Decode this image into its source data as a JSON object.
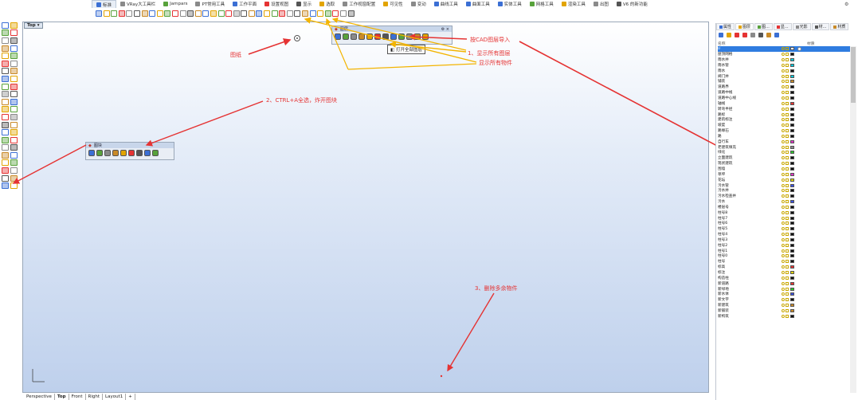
{
  "tabs": [
    {
      "label": "标准",
      "color": "#3b6fd4",
      "active": true
    },
    {
      "label": "VRay大工具栏",
      "color": "#8a8a8a"
    },
    {
      "label": "Jampars",
      "color": "#58a23b"
    },
    {
      "label": "PT常用工具",
      "color": "#8a8a8a"
    },
    {
      "label": "工作平面",
      "color": "#3b6fd4"
    },
    {
      "label": "设置视图",
      "color": "#e53333"
    },
    {
      "label": "显示",
      "color": "#555555"
    },
    {
      "label": "选取",
      "color": "#e2a400"
    },
    {
      "label": "工作视窗配置",
      "color": "#8a8a8a"
    },
    {
      "label": "可见性",
      "color": "#e2a400"
    },
    {
      "label": "变动",
      "color": "#8a8a8a"
    },
    {
      "label": "曲线工具",
      "color": "#3b6fd4"
    },
    {
      "label": "曲面工具",
      "color": "#3b6fd4"
    },
    {
      "label": "实体工具",
      "color": "#3b6fd4"
    },
    {
      "label": "网格工具",
      "color": "#58a23b"
    },
    {
      "label": "渲染工具",
      "color": "#e2a400"
    },
    {
      "label": "出图",
      "color": "#8a8a8a"
    },
    {
      "label": "V6 的新功能",
      "color": "#555555"
    }
  ],
  "toolbar_icons": [
    "new-file",
    "open-file",
    "save",
    "print",
    "import",
    "cut",
    "copy",
    "paste",
    "undo",
    "pan",
    "rotate",
    "zoom",
    "zoom-window",
    "zoom-extents",
    "zoom-selected",
    "undo-view",
    "grid",
    "cplane",
    "snap",
    "ortho",
    "planar",
    "osnap",
    "record",
    "lightbulb",
    "layer",
    "layer-on",
    "material",
    "render",
    "display",
    "shaded",
    "rendered",
    "camera",
    "light",
    "help"
  ],
  "viewport": {
    "title": "Top"
  },
  "annotations": {
    "drawing": "图纸",
    "select_explode": "2、CTRL+A全选，炸开图块",
    "cad_import": "按CAD图层导入",
    "show_layers": "1、显示所有图层",
    "show_objects": "显示所有物件",
    "delete_extra": "3、删除多余物件"
  },
  "layers_panel": {
    "title": "图层"
  },
  "blocks_panel": {
    "title": "图块"
  },
  "tooltip": "打开全部图层",
  "right_panel": {
    "tabs": [
      "属性",
      "图层",
      "图...",
      "显...",
      "光影",
      "材...",
      "材质"
    ],
    "columns": {
      "name": "名称",
      "material": "材质"
    },
    "layers": [
      {
        "name": "0",
        "color": "#ffffff",
        "selected": true
      },
      {
        "name": "屋顶网格",
        "color": "#111111"
      },
      {
        "name": "雨水井",
        "color": "#00c8d8"
      },
      {
        "name": "雨水管",
        "color": "#00c8d8"
      },
      {
        "name": "雨水",
        "color": "#111111"
      },
      {
        "name": "阀门井",
        "color": "#00c8d8"
      },
      {
        "name": "铺装",
        "color": "#c98a28"
      },
      {
        "name": "道路界",
        "color": "#111111"
      },
      {
        "name": "道路中线",
        "color": "#111111"
      },
      {
        "name": "道路中心线",
        "color": "#111111"
      },
      {
        "name": "轴线",
        "color": "#e53333"
      },
      {
        "name": "转弯半径",
        "color": "#111111"
      },
      {
        "name": "路标",
        "color": "#111111"
      },
      {
        "name": "建筑标注",
        "color": "#111111"
      },
      {
        "name": "坡度",
        "color": "#111111"
      },
      {
        "name": "路缘石",
        "color": "#111111"
      },
      {
        "name": "路",
        "color": "#111111"
      },
      {
        "name": "自行车",
        "color": "#e233c8"
      },
      {
        "name": "老建筑填充",
        "color": "#888888"
      },
      {
        "name": "绿化",
        "color": "#2ec82e"
      },
      {
        "name": "立面建筑",
        "color": "#111111"
      },
      {
        "name": "现状建筑",
        "color": "#111111"
      },
      {
        "name": "围墙",
        "color": "#111111"
      },
      {
        "name": "草坪",
        "color": "#e233c8"
      },
      {
        "name": "花坛",
        "color": "#e2d400"
      },
      {
        "name": "污水管",
        "color": "#3b4fe0"
      },
      {
        "name": "污水井",
        "color": "#111111"
      },
      {
        "name": "污水检查井",
        "color": "#111111"
      },
      {
        "name": "污水",
        "color": "#3b4fe0"
      },
      {
        "name": "楼层号",
        "color": "#111111"
      },
      {
        "name": "柱号8",
        "color": "#111111"
      },
      {
        "name": "柱号7",
        "color": "#111111"
      },
      {
        "name": "柱号6",
        "color": "#111111"
      },
      {
        "name": "柱号5",
        "color": "#111111"
      },
      {
        "name": "柱号4",
        "color": "#111111"
      },
      {
        "name": "柱号3",
        "color": "#111111"
      },
      {
        "name": "柱号2",
        "color": "#111111"
      },
      {
        "name": "柱号1",
        "color": "#111111"
      },
      {
        "name": "柱号0",
        "color": "#111111"
      },
      {
        "name": "柱号",
        "color": "#111111"
      },
      {
        "name": "标高",
        "color": "#e53333"
      },
      {
        "name": "标注",
        "color": "#e2d400"
      },
      {
        "name": "构造柱",
        "color": "#111111"
      },
      {
        "name": "新道路",
        "color": "#e53333"
      },
      {
        "name": "新绿地",
        "color": "#2ec82e"
      },
      {
        "name": "新水体",
        "color": "#3b4fe0"
      },
      {
        "name": "新文字",
        "color": "#111111"
      },
      {
        "name": "新建筑",
        "color": "#c98a28"
      },
      {
        "name": "新铺装",
        "color": "#c98a28"
      },
      {
        "name": "新构筑",
        "color": "#111111"
      }
    ]
  },
  "bottom_tabs": [
    {
      "label": "Perspective",
      "active": false
    },
    {
      "label": "Top",
      "active": true
    },
    {
      "label": "Front",
      "active": false
    },
    {
      "label": "Right",
      "active": false
    },
    {
      "label": "Layout1",
      "active": false
    },
    {
      "label": "+",
      "active": false
    }
  ]
}
